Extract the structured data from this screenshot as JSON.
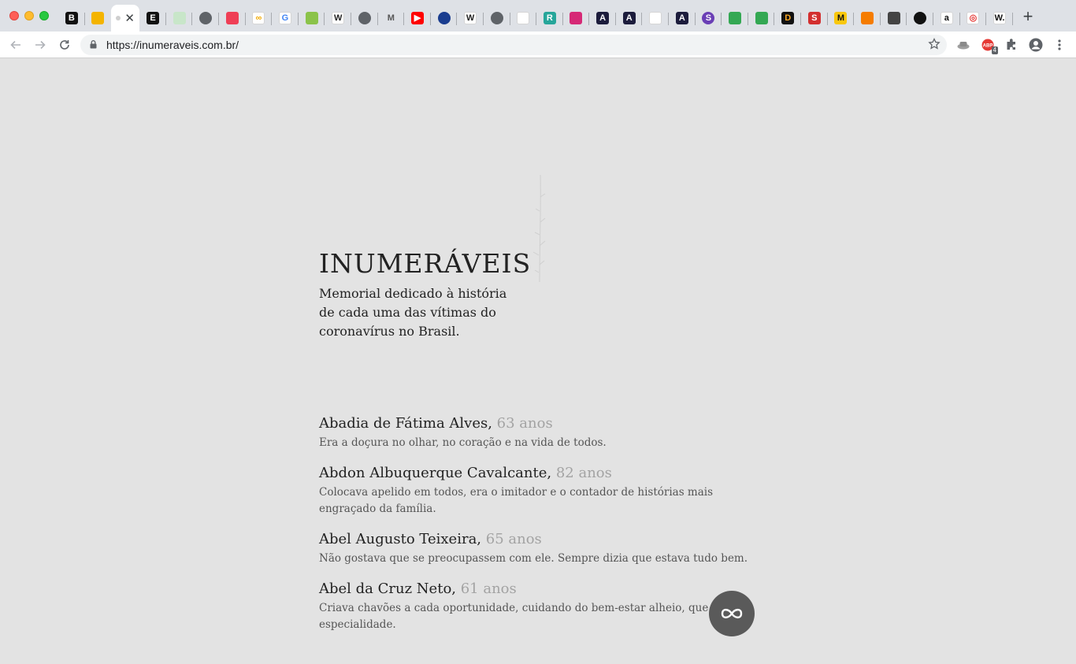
{
  "browser": {
    "url": "https://inumeraveis.com.br/",
    "tabs": [
      {
        "icon": "b-icon",
        "letter": "B",
        "bg": "#111111",
        "fg": "#ffffff"
      },
      {
        "icon": "slides-icon",
        "letter": "",
        "bg": "#f4b400",
        "fg": "#ffffff"
      },
      {
        "icon": "inumeraveis-tab",
        "letter": "",
        "bg": "",
        "fg": "",
        "active": true
      },
      {
        "icon": "e-icon",
        "letter": "E",
        "bg": "#111111",
        "fg": "#ffffff"
      },
      {
        "icon": "sheets-icon",
        "letter": "",
        "bg": "#c8e6c9",
        "fg": "#43a047"
      },
      {
        "icon": "globe-icon",
        "letter": "",
        "bg": "#5f6368",
        "fg": "#ffffff",
        "round": true
      },
      {
        "icon": "pocket-icon",
        "letter": "",
        "bg": "#ef3f56",
        "fg": "#ffffff"
      },
      {
        "icon": "infinity-icon",
        "letter": "∞",
        "bg": "#ffffff",
        "fg": "#f2a900"
      },
      {
        "icon": "google-icon",
        "letter": "G",
        "bg": "#ffffff",
        "fg": "#4285f4"
      },
      {
        "icon": "leaf-icon",
        "letter": "",
        "bg": "#8bc34a",
        "fg": "#ffffff"
      },
      {
        "icon": "wikipedia-icon",
        "letter": "W",
        "bg": "#ffffff",
        "fg": "#222222"
      },
      {
        "icon": "globe-icon",
        "letter": "",
        "bg": "#5f6368",
        "fg": "#ffffff",
        "round": true
      },
      {
        "icon": "medium-icon",
        "letter": "M",
        "bg": "#dee1e6",
        "fg": "#555555"
      },
      {
        "icon": "youtube-icon",
        "letter": "▶",
        "bg": "#ff0000",
        "fg": "#ffffff"
      },
      {
        "icon": "blue-dot-icon",
        "letter": "",
        "bg": "#1a3d8f",
        "fg": "#ffffff",
        "round": true
      },
      {
        "icon": "wikipedia-icon",
        "letter": "W",
        "bg": "#ffffff",
        "fg": "#222222"
      },
      {
        "icon": "globe-icon",
        "letter": "",
        "bg": "#5f6368",
        "fg": "#ffffff",
        "round": true
      },
      {
        "icon": "book-icon",
        "letter": "",
        "bg": "#ffffff",
        "fg": "#e64a19"
      },
      {
        "icon": "r-icon",
        "letter": "R",
        "bg": "#26a69a",
        "fg": "#ffffff"
      },
      {
        "icon": "instagram-icon",
        "letter": "",
        "bg": "#d62976",
        "fg": "#ffffff"
      },
      {
        "icon": "a-icon",
        "letter": "A",
        "bg": "#1c1c3c",
        "fg": "#ffffff"
      },
      {
        "icon": "a-icon",
        "letter": "A",
        "bg": "#1c1c3c",
        "fg": "#ffffff"
      },
      {
        "icon": "drop-icon",
        "letter": "",
        "bg": "#ffffff",
        "fg": "#e53935"
      },
      {
        "icon": "a-icon",
        "letter": "A",
        "bg": "#1c1c3c",
        "fg": "#ffffff"
      },
      {
        "icon": "s-icon",
        "letter": "S",
        "bg": "#6a3fb5",
        "fg": "#ffffff",
        "round": true
      },
      {
        "icon": "drive-icon",
        "letter": "",
        "bg": "#34a853",
        "fg": "#ffffff"
      },
      {
        "icon": "drive-icon",
        "letter": "",
        "bg": "#34a853",
        "fg": "#ffffff"
      },
      {
        "icon": "d-icon",
        "letter": "D",
        "bg": "#111111",
        "fg": "#f9a825"
      },
      {
        "icon": "s-red-icon",
        "letter": "S",
        "bg": "#d32f2f",
        "fg": "#ffffff"
      },
      {
        "icon": "m-yellow-icon",
        "letter": "M",
        "bg": "#f9c80e",
        "fg": "#111111"
      },
      {
        "icon": "orange-grid-icon",
        "letter": "",
        "bg": "#f57c00",
        "fg": "#ffffff"
      },
      {
        "icon": "pen-icon",
        "letter": "",
        "bg": "#444444",
        "fg": "#ffffff"
      },
      {
        "icon": "black-circle-icon",
        "letter": "",
        "bg": "#111111",
        "fg": "#ffffff",
        "round": true
      },
      {
        "icon": "amazon-icon",
        "letter": "a",
        "bg": "#ffffff",
        "fg": "#111111"
      },
      {
        "icon": "target-icon",
        "letter": "◎",
        "bg": "#ffffff",
        "fg": "#e53935"
      },
      {
        "icon": "w-dot-icon",
        "letter": "W.",
        "bg": "#ffffff",
        "fg": "#111111"
      }
    ],
    "extensions_badge": "4"
  },
  "site": {
    "title": "INUMERÁVEIS",
    "subtitle": "Memorial dedicado à história de cada uma das vítimas do coronavírus no Brasil."
  },
  "entries": [
    {
      "name": "Abadia de Fátima Alves,",
      "age": "63 anos",
      "text": "Era a doçura no olhar, no coração e na vida de todos."
    },
    {
      "name": "Abdon Albuquerque Cavalcante,",
      "age": "82 anos",
      "text": "Colocava apelido em todos, era o imitador e o contador de histórias mais engraçado da família."
    },
    {
      "name": "Abel Augusto Teixeira,",
      "age": "65 anos",
      "text": "Não gostava que se preocupassem com ele. Sempre dizia que estava tudo bem."
    },
    {
      "name": "Abel da Cruz Neto,",
      "age": "61 anos",
      "text": "Criava chavões a cada oportunidade, cuidando do bem-estar alheio, que era sua especialidade."
    }
  ]
}
